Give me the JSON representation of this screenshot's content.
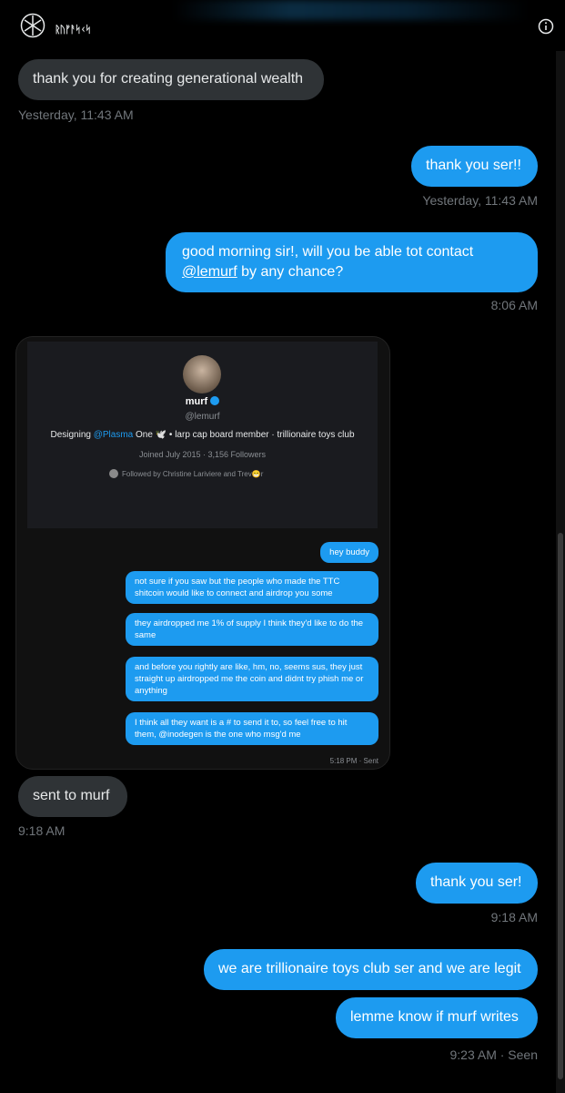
{
  "header": {
    "title": "ᚱᚢᚠᚨᛋᚲᛋ"
  },
  "messages": [
    {
      "text": "thank you for creating generational wealth",
      "time": "Yesterday, 11:43 AM"
    },
    {
      "text": "thank you ser!!",
      "time": "Yesterday, 11:43 AM"
    },
    {
      "text_before": "good morning sir!, will you be able tot contact",
      "mention": "@lemurf",
      "text_after": " by any chance?",
      "time": "8:06 AM"
    },
    {
      "text": "sent to murf",
      "time": "9:18 AM"
    },
    {
      "text": "thank you ser!",
      "time": "9:18 AM"
    },
    {
      "text": "we are trillionaire toys club ser and we are legit"
    },
    {
      "text": "lemme know if murf writes",
      "time": "9:23 AM · Seen"
    }
  ],
  "attachment": {
    "profile": {
      "name": "murf",
      "handle": "@lemurf",
      "bio_prefix": "Designing ",
      "bio_link": "@Plasma",
      "bio_suffix": " One 🕊️ • larp cap board member · trillionaire toys club",
      "joined": "Joined July 2015 · 3,156 Followers",
      "followed_by": "Followed by Christine Lariviere and Trev😁r"
    },
    "inner_messages": [
      "hey buddy",
      "not sure if you saw but the people who made the TTC shitcoin would like to connect and airdrop you some",
      "they airdropped me 1% of supply I think they'd like to do the same",
      "and before you rightly are like, hm, no, seems sus, they just straight up airdropped me the coin and didnt try phish me or anything",
      "I think all they want is a # to send it to, so feel free to hit them, @inodegen is the one who msg'd me"
    ],
    "inner_meta": "5:18 PM · Sent"
  }
}
